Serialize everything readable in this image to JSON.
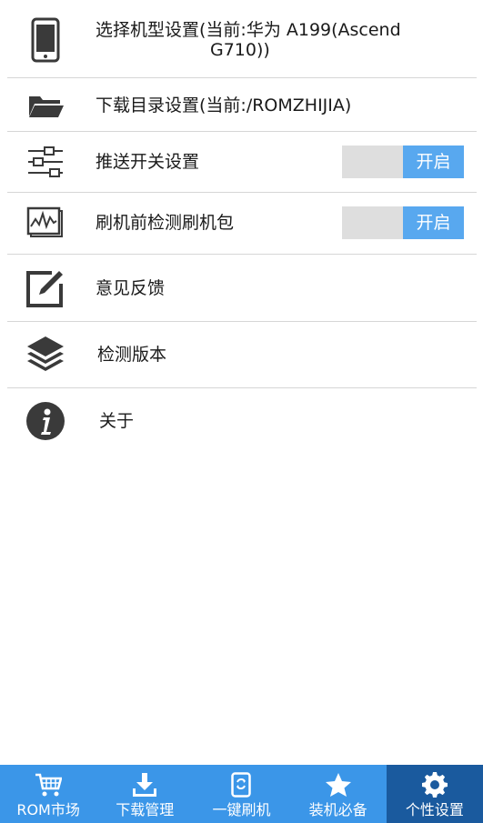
{
  "settings": {
    "items": [
      {
        "label": "选择机型设置(当前:华为 A199(Ascend",
        "label_line2": "G710))",
        "icon": "phone-icon"
      },
      {
        "label": "下载目录设置(当前:/ROMZHIJIA)",
        "icon": "folder-icon"
      },
      {
        "label": "推送开关设置",
        "icon": "sliders-icon",
        "toggle": "开启",
        "toggle_on": true
      },
      {
        "label": "刷机前检测刷机包",
        "icon": "monitor-chart-icon",
        "toggle": "开启",
        "toggle_on": true
      },
      {
        "label": "意见反馈",
        "icon": "edit-icon"
      },
      {
        "label": "检测版本",
        "icon": "layers-icon"
      },
      {
        "label": "关于",
        "icon": "info-icon"
      }
    ]
  },
  "bottom_nav": {
    "items": [
      {
        "label": "ROM市场",
        "icon": "cart-icon"
      },
      {
        "label": "下载管理",
        "icon": "download-icon"
      },
      {
        "label": "一键刷机",
        "icon": "phone-refresh-icon"
      },
      {
        "label": "装机必备",
        "icon": "star-icon"
      },
      {
        "label": "个性设置",
        "icon": "gear-icon",
        "active": true
      }
    ]
  },
  "colors": {
    "accent": "#3b96e8",
    "accent_active": "#1a5a9e",
    "toggle_on": "#58a8ef",
    "toggle_track": "#dedede",
    "icon": "#3a3a3a"
  }
}
